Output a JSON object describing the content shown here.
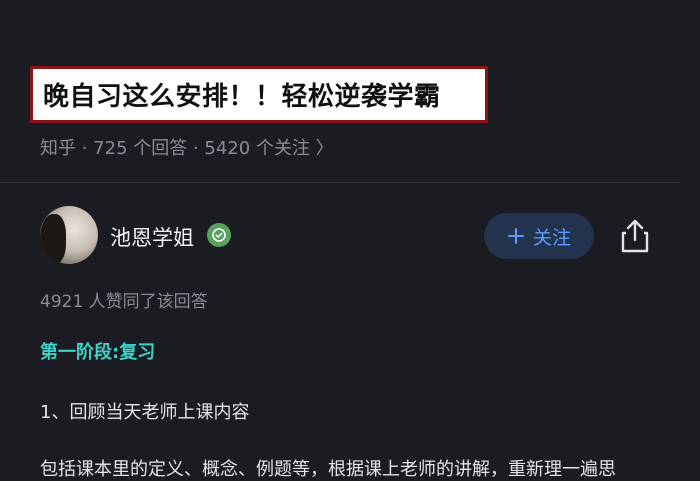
{
  "question": {
    "title": "晚自习这么安排！！轻松逆袭学霸",
    "meta": "知乎 · 725 个回答 · 5420 个关注 〉"
  },
  "answer": {
    "author_name": "池恩学姐",
    "follow_label": "关注",
    "likes_text": "4921 人赞同了该回答",
    "section_title": "第一阶段:复习",
    "item_1": "1、回顾当天老师上课内容",
    "paragraph": "包括课本里的定义、概念、例题等，根据课上老师的讲解，重新理一遍思"
  },
  "icons": {
    "follow": "plus-icon",
    "share": "share-icon",
    "badge": "verified-badge-icon"
  },
  "colors": {
    "background": "#1b1c21",
    "accent": "#5d9cff",
    "section": "#3fd0c9",
    "highlight_border": "#8a1418"
  }
}
